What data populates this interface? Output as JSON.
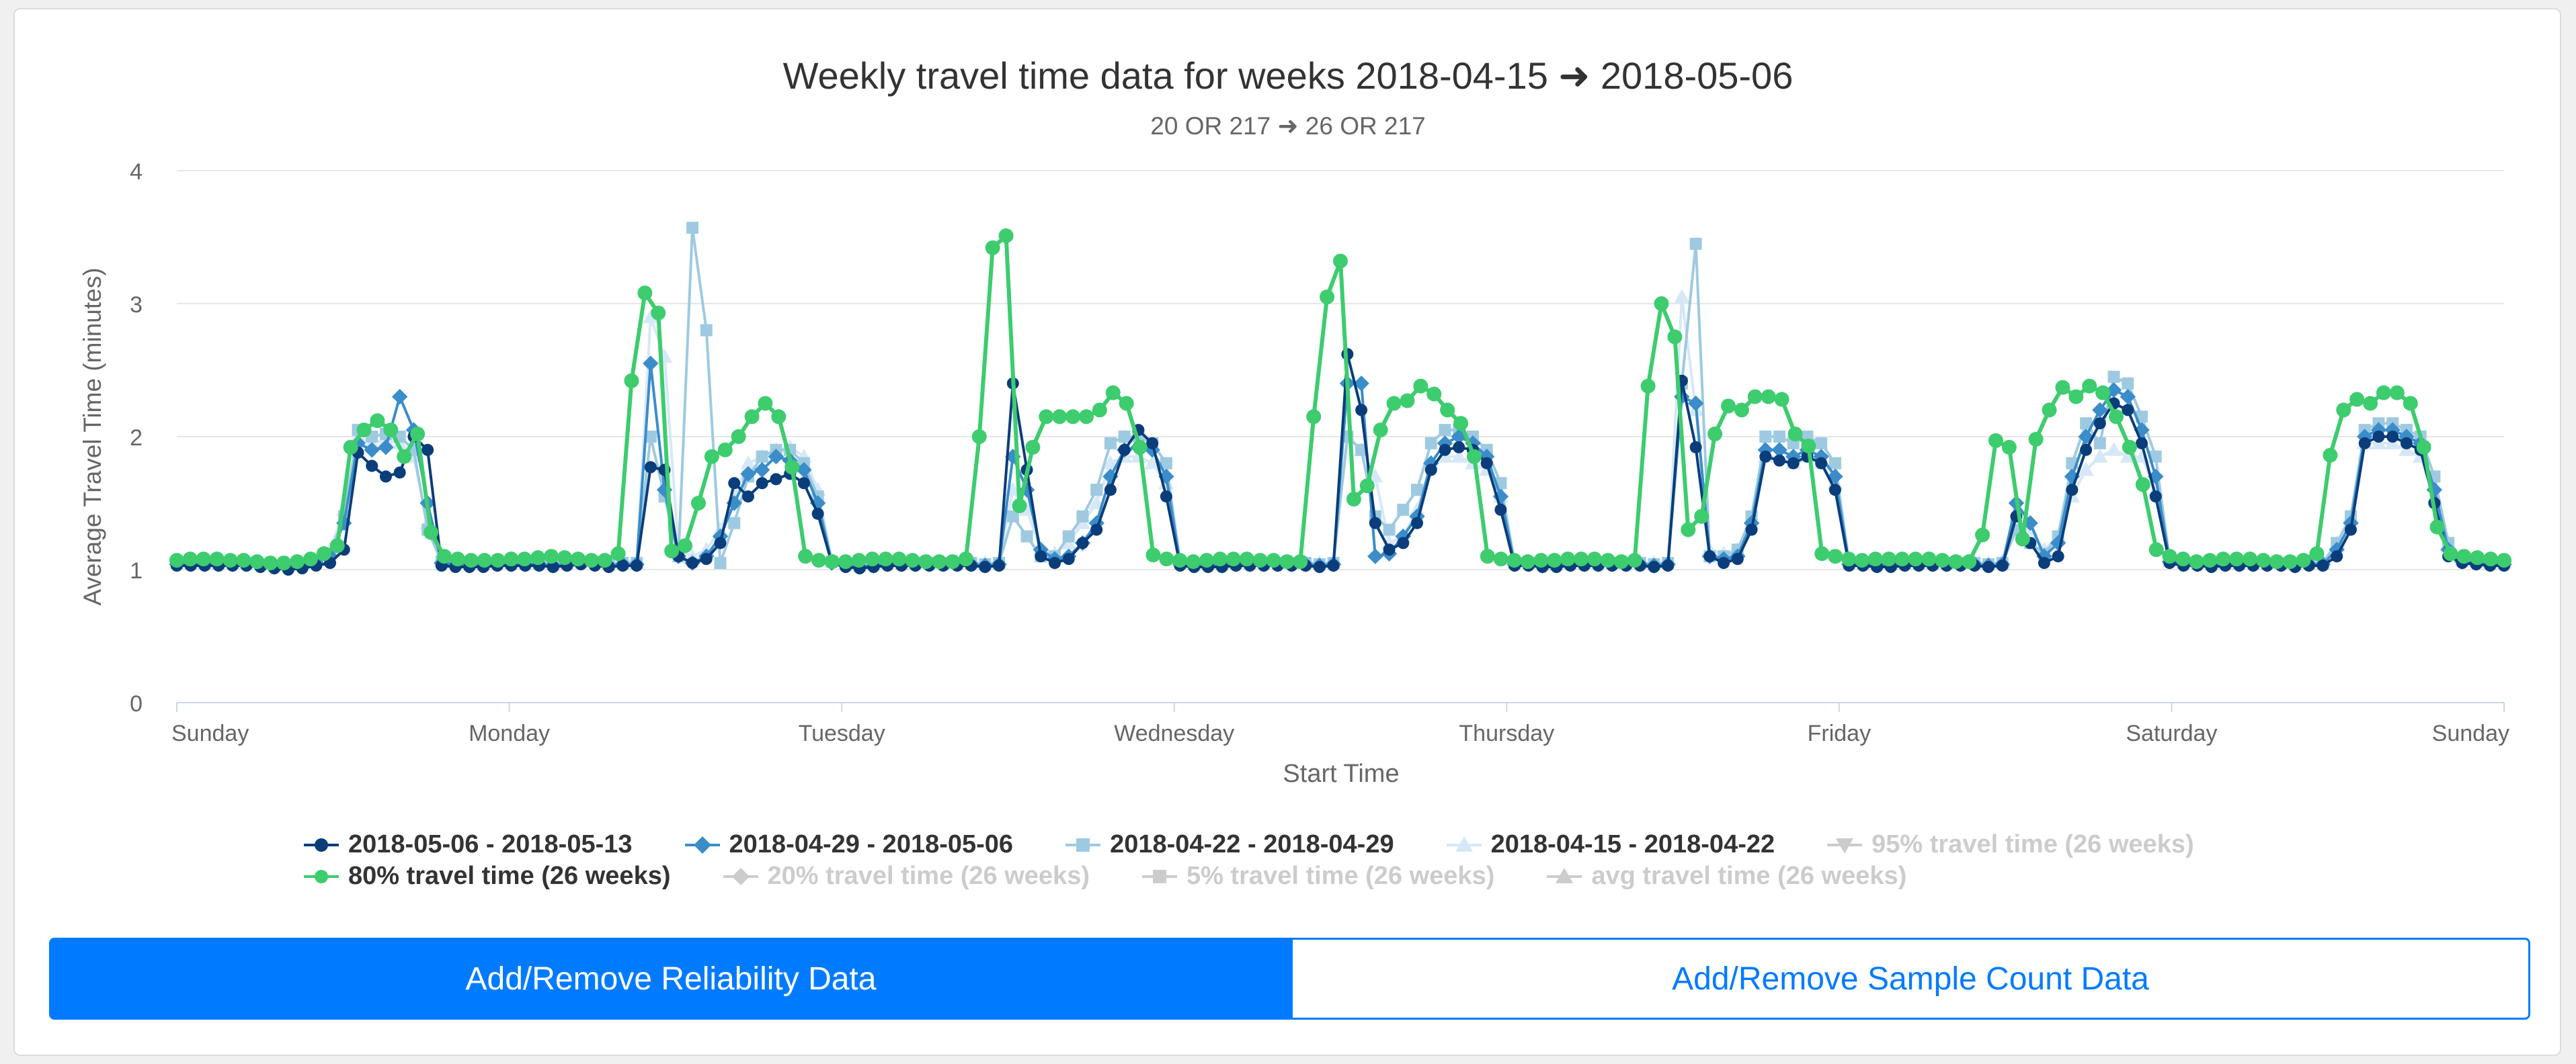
{
  "chart_data": {
    "type": "line",
    "title": "Weekly travel time data for weeks 2018-04-15 ➜ 2018-05-06",
    "subtitle": "20 OR 217 ➜ 26 OR 217",
    "xlabel": "Start Time",
    "ylabel": "Average Travel Time (minutes)",
    "ylim": [
      0,
      4
    ],
    "yticks": [
      "0",
      "1",
      "2",
      "3",
      "4"
    ],
    "xticks": [
      "Sunday",
      "Monday",
      "Tuesday",
      "Wednesday",
      "Thursday",
      "Friday",
      "Saturday",
      "Sunday"
    ],
    "grid": true,
    "legend_position": "bottom",
    "series": [
      {
        "name": "2018-05-06 - 2018-05-13",
        "color": "#0a3d7a",
        "marker": "circle",
        "visible": true,
        "y": [
          1.03,
          1.03,
          1.03,
          1.03,
          1.03,
          1.03,
          1.02,
          1.01,
          1.0,
          1.01,
          1.03,
          1.05,
          1.15,
          1.88,
          1.78,
          1.7,
          1.73,
          2.0,
          1.9,
          1.03,
          1.02,
          1.02,
          1.02,
          1.03,
          1.03,
          1.03,
          1.03,
          1.02,
          1.03,
          1.04,
          1.03,
          1.02,
          1.03,
          1.03,
          1.77,
          1.75,
          1.1,
          1.05,
          1.08,
          1.2,
          1.65,
          1.55,
          1.65,
          1.68,
          1.72,
          1.65,
          1.42,
          1.05,
          1.02,
          1.01,
          1.02,
          1.03,
          1.03,
          1.03,
          1.03,
          1.03,
          1.03,
          1.03,
          1.02,
          1.03,
          2.4,
          1.75,
          1.1,
          1.05,
          1.08,
          1.2,
          1.3,
          1.6,
          1.9,
          2.05,
          1.95,
          1.55,
          1.03,
          1.02,
          1.02,
          1.02,
          1.03,
          1.03,
          1.03,
          1.03,
          1.03,
          1.03,
          1.02,
          1.03,
          2.62,
          2.2,
          1.35,
          1.15,
          1.2,
          1.35,
          1.75,
          1.9,
          1.92,
          1.9,
          1.8,
          1.45,
          1.03,
          1.03,
          1.02,
          1.02,
          1.03,
          1.03,
          1.03,
          1.03,
          1.03,
          1.03,
          1.02,
          1.03,
          2.42,
          1.92,
          1.1,
          1.05,
          1.08,
          1.3,
          1.85,
          1.82,
          1.8,
          1.85,
          1.8,
          1.6,
          1.03,
          1.03,
          1.02,
          1.02,
          1.03,
          1.03,
          1.03,
          1.03,
          1.03,
          1.03,
          1.02,
          1.03,
          1.4,
          1.2,
          1.05,
          1.1,
          1.6,
          1.9,
          2.1,
          2.25,
          2.2,
          1.95,
          1.55,
          1.05,
          1.03,
          1.03,
          1.02,
          1.03,
          1.03,
          1.03,
          1.03,
          1.03,
          1.02,
          1.03,
          1.03,
          1.1,
          1.3,
          1.95,
          2.0,
          2.0,
          1.95,
          1.9,
          1.5,
          1.1,
          1.05,
          1.04,
          1.03,
          1.03
        ]
      },
      {
        "name": "2018-04-29 - 2018-05-06",
        "color": "#3a8dc9",
        "marker": "diamond",
        "visible": true,
        "y": [
          1.04,
          1.04,
          1.04,
          1.04,
          1.04,
          1.04,
          1.03,
          1.02,
          1.02,
          1.03,
          1.05,
          1.1,
          1.35,
          1.95,
          1.9,
          1.92,
          2.3,
          2.05,
          1.5,
          1.05,
          1.04,
          1.03,
          1.03,
          1.04,
          1.04,
          1.04,
          1.04,
          1.03,
          1.04,
          1.05,
          1.05,
          1.03,
          1.04,
          1.04,
          2.55,
          1.6,
          1.1,
          1.05,
          1.1,
          1.25,
          1.5,
          1.72,
          1.75,
          1.85,
          1.82,
          1.75,
          1.5,
          1.05,
          1.03,
          1.02,
          1.03,
          1.04,
          1.04,
          1.04,
          1.04,
          1.04,
          1.04,
          1.04,
          1.03,
          1.04,
          1.85,
          1.6,
          1.15,
          1.08,
          1.1,
          1.2,
          1.35,
          1.7,
          1.9,
          1.92,
          1.9,
          1.7,
          1.04,
          1.03,
          1.03,
          1.03,
          1.04,
          1.04,
          1.04,
          1.04,
          1.04,
          1.04,
          1.03,
          1.04,
          2.4,
          2.4,
          1.1,
          1.12,
          1.25,
          1.4,
          1.8,
          1.95,
          2.0,
          1.95,
          1.85,
          1.55,
          1.04,
          1.04,
          1.03,
          1.03,
          1.04,
          1.04,
          1.04,
          1.04,
          1.04,
          1.04,
          1.03,
          1.04,
          2.3,
          2.25,
          1.1,
          1.08,
          1.1,
          1.35,
          1.9,
          1.9,
          1.85,
          1.9,
          1.85,
          1.7,
          1.04,
          1.04,
          1.03,
          1.03,
          1.04,
          1.04,
          1.04,
          1.04,
          1.04,
          1.04,
          1.03,
          1.04,
          1.5,
          1.35,
          1.1,
          1.2,
          1.7,
          2.0,
          2.2,
          2.35,
          2.3,
          2.05,
          1.7,
          1.06,
          1.04,
          1.04,
          1.03,
          1.04,
          1.04,
          1.04,
          1.04,
          1.04,
          1.03,
          1.04,
          1.04,
          1.15,
          1.35,
          2.0,
          2.05,
          2.05,
          2.0,
          1.95,
          1.6,
          1.15,
          1.06,
          1.05,
          1.04,
          1.04
        ]
      },
      {
        "name": "2018-04-22 - 2018-04-29",
        "color": "#9ecae1",
        "marker": "square",
        "visible": true,
        "y": [
          1.05,
          1.05,
          1.05,
          1.05,
          1.05,
          1.05,
          1.04,
          1.03,
          1.03,
          1.04,
          1.06,
          1.12,
          1.4,
          2.05,
          2.0,
          2.02,
          2.0,
          1.9,
          1.3,
          1.06,
          1.05,
          1.04,
          1.04,
          1.05,
          1.05,
          1.05,
          1.05,
          1.04,
          1.05,
          1.06,
          1.06,
          1.04,
          1.05,
          1.05,
          2.0,
          1.55,
          1.1,
          3.57,
          2.8,
          1.05,
          1.35,
          1.7,
          1.85,
          1.9,
          1.9,
          1.8,
          1.55,
          1.06,
          1.04,
          1.03,
          1.04,
          1.05,
          1.05,
          1.05,
          1.05,
          1.05,
          1.05,
          1.05,
          1.04,
          1.05,
          1.4,
          1.25,
          1.1,
          1.1,
          1.25,
          1.4,
          1.6,
          1.95,
          2.0,
          2.0,
          1.95,
          1.8,
          1.05,
          1.04,
          1.04,
          1.04,
          1.05,
          1.05,
          1.05,
          1.05,
          1.05,
          1.05,
          1.04,
          1.05,
          2.0,
          1.9,
          1.4,
          1.3,
          1.45,
          1.6,
          1.95,
          2.05,
          2.05,
          2.0,
          1.9,
          1.65,
          1.05,
          1.05,
          1.04,
          1.04,
          1.05,
          1.05,
          1.05,
          1.05,
          1.05,
          1.05,
          1.04,
          1.05,
          2.4,
          3.45,
          1.1,
          1.1,
          1.15,
          1.4,
          2.0,
          2.0,
          1.95,
          2.0,
          1.95,
          1.8,
          1.05,
          1.05,
          1.04,
          1.04,
          1.05,
          1.05,
          1.05,
          1.05,
          1.05,
          1.05,
          1.04,
          1.05,
          1.3,
          1.2,
          1.12,
          1.25,
          1.8,
          2.1,
          1.95,
          2.45,
          2.4,
          2.15,
          1.85,
          1.07,
          1.05,
          1.05,
          1.04,
          1.05,
          1.05,
          1.05,
          1.05,
          1.05,
          1.04,
          1.05,
          1.05,
          1.2,
          1.4,
          2.05,
          2.1,
          2.1,
          2.05,
          2.0,
          1.7,
          1.2,
          1.07,
          1.06,
          1.05,
          1.05
        ]
      },
      {
        "name": "2018-04-15 - 2018-04-22",
        "color": "#d6e8f7",
        "marker": "triangle",
        "visible": true,
        "y": [
          1.06,
          1.06,
          1.06,
          1.06,
          1.06,
          1.06,
          1.05,
          1.04,
          1.04,
          1.05,
          1.07,
          1.15,
          1.45,
          2.0,
          1.95,
          1.98,
          1.95,
          1.85,
          1.35,
          1.07,
          1.06,
          1.05,
          1.05,
          1.06,
          1.06,
          1.06,
          1.06,
          1.05,
          1.06,
          1.07,
          1.07,
          1.05,
          1.06,
          1.06,
          2.9,
          2.6,
          1.15,
          1.1,
          1.15,
          1.3,
          1.55,
          1.8,
          1.85,
          1.9,
          1.92,
          1.85,
          1.6,
          1.07,
          1.05,
          1.04,
          1.05,
          1.06,
          1.06,
          1.06,
          1.06,
          1.06,
          1.06,
          1.06,
          1.05,
          1.06,
          1.6,
          1.45,
          1.15,
          1.12,
          1.2,
          1.35,
          1.5,
          1.8,
          1.85,
          1.85,
          1.8,
          1.65,
          1.06,
          1.05,
          1.05,
          1.05,
          1.06,
          1.06,
          1.06,
          1.06,
          1.06,
          1.06,
          1.05,
          1.06,
          2.0,
          1.9,
          1.7,
          1.2,
          1.25,
          1.45,
          1.8,
          1.85,
          1.85,
          1.8,
          1.75,
          1.55,
          1.06,
          1.06,
          1.05,
          1.05,
          1.06,
          1.06,
          1.06,
          1.06,
          1.06,
          1.06,
          1.05,
          1.06,
          3.05,
          2.2,
          1.15,
          1.12,
          1.15,
          1.35,
          1.85,
          1.85,
          1.8,
          1.85,
          1.8,
          1.65,
          1.06,
          1.06,
          1.05,
          1.05,
          1.06,
          1.06,
          1.06,
          1.06,
          1.06,
          1.06,
          1.05,
          1.06,
          1.4,
          1.3,
          1.15,
          1.25,
          1.55,
          1.75,
          1.85,
          1.9,
          1.85,
          1.85,
          1.6,
          1.08,
          1.06,
          1.06,
          1.05,
          1.06,
          1.06,
          1.06,
          1.06,
          1.06,
          1.05,
          1.06,
          1.06,
          1.2,
          1.4,
          1.95,
          1.95,
          1.95,
          1.9,
          1.85,
          1.55,
          1.2,
          1.08,
          1.07,
          1.06,
          1.06
        ]
      },
      {
        "name": "95% travel time (26 weeks)",
        "color": "#cccccc",
        "marker": "triangle-down",
        "visible": false,
        "y": []
      },
      {
        "name": "80% travel time (26 weeks)",
        "color": "#3dcc6e",
        "marker": "circle",
        "visible": true,
        "y": [
          1.07,
          1.08,
          1.08,
          1.08,
          1.07,
          1.07,
          1.06,
          1.05,
          1.05,
          1.06,
          1.08,
          1.12,
          1.18,
          1.92,
          2.05,
          2.12,
          2.05,
          1.85,
          2.02,
          1.28,
          1.1,
          1.08,
          1.07,
          1.07,
          1.07,
          1.08,
          1.08,
          1.09,
          1.1,
          1.09,
          1.08,
          1.07,
          1.07,
          1.12,
          2.42,
          3.08,
          2.93,
          1.14,
          1.18,
          1.5,
          1.85,
          1.9,
          2.0,
          2.15,
          2.25,
          2.15,
          1.77,
          1.1,
          1.07,
          1.06,
          1.06,
          1.07,
          1.08,
          1.08,
          1.08,
          1.07,
          1.06,
          1.06,
          1.06,
          1.08,
          2.0,
          3.42,
          3.51,
          1.48,
          1.92,
          2.15,
          2.15,
          2.15,
          2.15,
          2.2,
          2.33,
          2.25,
          1.92,
          1.11,
          1.08,
          1.07,
          1.06,
          1.07,
          1.08,
          1.08,
          1.08,
          1.07,
          1.07,
          1.06,
          1.06,
          2.15,
          3.05,
          3.32,
          1.53,
          1.63,
          2.05,
          2.25,
          2.27,
          2.38,
          2.32,
          2.2,
          2.1,
          1.85,
          1.1,
          1.08,
          1.07,
          1.06,
          1.07,
          1.07,
          1.08,
          1.08,
          1.08,
          1.07,
          1.06,
          1.07,
          2.38,
          3.0,
          2.75,
          1.3,
          1.4,
          2.02,
          2.23,
          2.2,
          2.3,
          2.3,
          2.28,
          2.02,
          1.93,
          1.12,
          1.1,
          1.08,
          1.07,
          1.08,
          1.08,
          1.08,
          1.08,
          1.08,
          1.07,
          1.06,
          1.06,
          1.26,
          1.97,
          1.92,
          1.23,
          1.98,
          2.2,
          2.37,
          2.3,
          2.38,
          2.33,
          2.15,
          1.92,
          1.64,
          1.15,
          1.1,
          1.08,
          1.06,
          1.07,
          1.08,
          1.08,
          1.08,
          1.07,
          1.06,
          1.06,
          1.07,
          1.12,
          1.86,
          2.2,
          2.28,
          2.25,
          2.33,
          2.33,
          2.25,
          1.92,
          1.32,
          1.12,
          1.1,
          1.09,
          1.08,
          1.07
        ]
      },
      {
        "name": "20% travel time (26 weeks)",
        "color": "#cccccc",
        "marker": "diamond",
        "visible": false,
        "y": []
      },
      {
        "name": "5% travel time (26 weeks)",
        "color": "#cccccc",
        "marker": "square",
        "visible": false,
        "y": []
      },
      {
        "name": "avg travel time (26 weeks)",
        "color": "#cccccc",
        "marker": "triangle",
        "visible": false,
        "y": []
      }
    ]
  },
  "buttons": {
    "reliability_label": "Add/Remove Reliability Data",
    "sample_count_label": "Add/Remove Sample Count Data"
  },
  "colors": {
    "accent": "#007bff",
    "hidden_legend": "#cccccc",
    "grid": "#e6e6e6"
  }
}
